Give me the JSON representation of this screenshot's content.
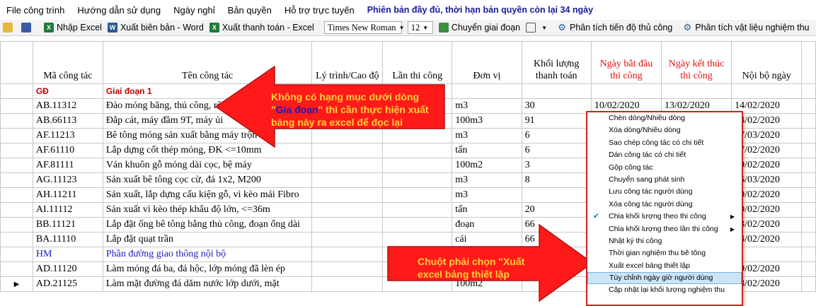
{
  "menu": [
    "File công trình",
    "Hướng dẫn sử dụng",
    "Ngày nghỉ",
    "Bản quyền",
    "Hỗ trợ trực tuyến"
  ],
  "license_notice": "Phiên bản đầy đủ, thời hạn bản quyền còn lại 34 ngày",
  "toolbar": {
    "export_excel": "Nhập Excel",
    "export_word": "Xuất biên bản - Word",
    "export_payment": "Xuất thanh toán - Excel",
    "font_name": "Times New Roman",
    "font_size": "12",
    "switch_stage": "Chuyển giai đoạn",
    "analyze_progress": "Phân tích tiến độ thủ công",
    "analyze_materials": "Phân tích vật liệu nghiệm thu"
  },
  "table": {
    "headers": [
      "Mã công tác",
      "Tên công tác",
      "Lý trình/Cao độ",
      "Lần thi công",
      "Đơn vị",
      "Khối lượng thanh toán",
      "Ngày bắt đầu thi công",
      "Ngày kết thúc thi công",
      "Nội bộ ngày"
    ],
    "rows": [
      {
        "code": "GĐ",
        "name": "Giai đoạn 1",
        "unit": "",
        "qty": "",
        "start": "",
        "end": "",
        "internal": ""
      },
      {
        "code": "AB.11312",
        "name": "Đào móng băng, thủ công, rộng",
        "unit": "m3",
        "qty": "30",
        "start": "10/02/2020",
        "end": "13/02/2020",
        "internal": "14/02/2020"
      },
      {
        "code": "AB.66113",
        "name": "Đắp cát, máy đầm 9T, máy ủi",
        "unit": "100m3",
        "qty": "91",
        "start": "",
        "end": "",
        "internal": "14/02/2020"
      },
      {
        "code": "AF.11213",
        "name": "Bê tông móng sản xuất bằng máy trộn",
        "unit": "m3",
        "qty": "6",
        "start": "",
        "end": "",
        "internal": "17/03/2020"
      },
      {
        "code": "AF.61110",
        "name": "Lắp dựng cốt thép móng, ĐK <=10mm",
        "unit": "tấn",
        "qty": "6",
        "start": "",
        "end": "",
        "internal": "17/02/2020"
      },
      {
        "code": "AF.81111",
        "name": "Ván khuôn gỗ móng dài cọc, bệ máy",
        "unit": "100m2",
        "qty": "3",
        "start": "",
        "end": "",
        "internal": "19/02/2020"
      },
      {
        "code": "AG.11123",
        "name": "Sản xuất bê tông cọc cừ, đá 1x2, M200",
        "unit": "m3",
        "qty": "8",
        "start": "",
        "end": "",
        "internal": "16/03/2020"
      },
      {
        "code": "AH.11211",
        "name": "Sản xuất, lắp dựng cấu kiện gỗ, vì kèo mái Fibro",
        "unit": "m3",
        "qty": "",
        "start": "",
        "end": "",
        "internal": "20/02/2020"
      },
      {
        "code": "AI.11112",
        "name": "Sản xuất vì kèo thép khẩu độ lớn, <=36m",
        "unit": "tấn",
        "qty": "20",
        "start": "",
        "end": "",
        "internal": "20/02/2020"
      },
      {
        "code": "BB.11121",
        "name": "Lắp đặt ống bê tông bằng thủ công, đoạn ống dài",
        "unit": "đoạn",
        "qty": "66",
        "start": "",
        "end": "",
        "internal": "23/02/2020"
      },
      {
        "code": "BA.11110",
        "name": "Lắp đặt quạt trần",
        "unit": "cái",
        "qty": "66",
        "start": "",
        "end": "",
        "internal": "24/02/2020"
      },
      {
        "code": "HM",
        "name": "Phần đường giao thông nội bộ",
        "unit": "",
        "qty": "",
        "start": "",
        "end": "",
        "internal": ""
      },
      {
        "code": "AD.11120",
        "name": "Làm móng đá ba, đá hộc, lớp móng đã lèn ép",
        "unit": "100m2",
        "qty": "",
        "start": "",
        "end": "",
        "internal": "29/02/2020"
      },
      {
        "code": "AD.21125",
        "name": "Làm mặt đường đá dăm nước lớp dưới, mặt",
        "unit": "100m2",
        "qty": "",
        "start": "",
        "end": "",
        "internal": "23/02/2020"
      }
    ]
  },
  "callout_top": {
    "line1": "Không có hạng mục dưới dòng",
    "quote_open": "\"",
    "highlight": "Gia đoạn",
    "line2_rest": "\" thì cần thực hiện xuất",
    "line3": "bảng này ra excel để đọc lại"
  },
  "callout_bottom": {
    "line1": "Chuột phải chọn \"Xuất",
    "line2": "excel  bảng thiết lập"
  },
  "context_menu": [
    {
      "label": "Chèn dòng/Nhiều dòng"
    },
    {
      "label": "Xóa dòng/Nhiều dòng"
    },
    {
      "label": "Sao chép công tác có chi tiết"
    },
    {
      "label": "Dán công tác có chi tiết"
    },
    {
      "label": "Gộp công tác"
    },
    {
      "label": "Chuyển sang phát sinh"
    },
    {
      "label": "Lưu công tác người dùng"
    },
    {
      "label": "Xóa công tác người dùng"
    },
    {
      "label": "Chia khối lượng theo thi công"
    },
    {
      "label": "Chia khối lượng theo lần thi công"
    },
    {
      "label": "Nhật ký thi công"
    },
    {
      "label": "Thời gian nghiệm thu bê tông"
    },
    {
      "label": "Xuất excel bảng thiết lập"
    },
    {
      "label": "Tùy chỉnh ngày giờ người dùng"
    },
    {
      "label": "Cập nhật lại khối lượng nghiệm thu"
    }
  ],
  "colors": {
    "arrow": "#ff1a1a",
    "arrow_border": "#b01010",
    "callout_text": "#ffd23a",
    "header_red": "#e01010",
    "stage_red": "#c00000",
    "link_blue": "#1a1ac0"
  },
  "icons": {
    "checked_item": "check-icon",
    "submenu": "chevron-right-icon"
  }
}
